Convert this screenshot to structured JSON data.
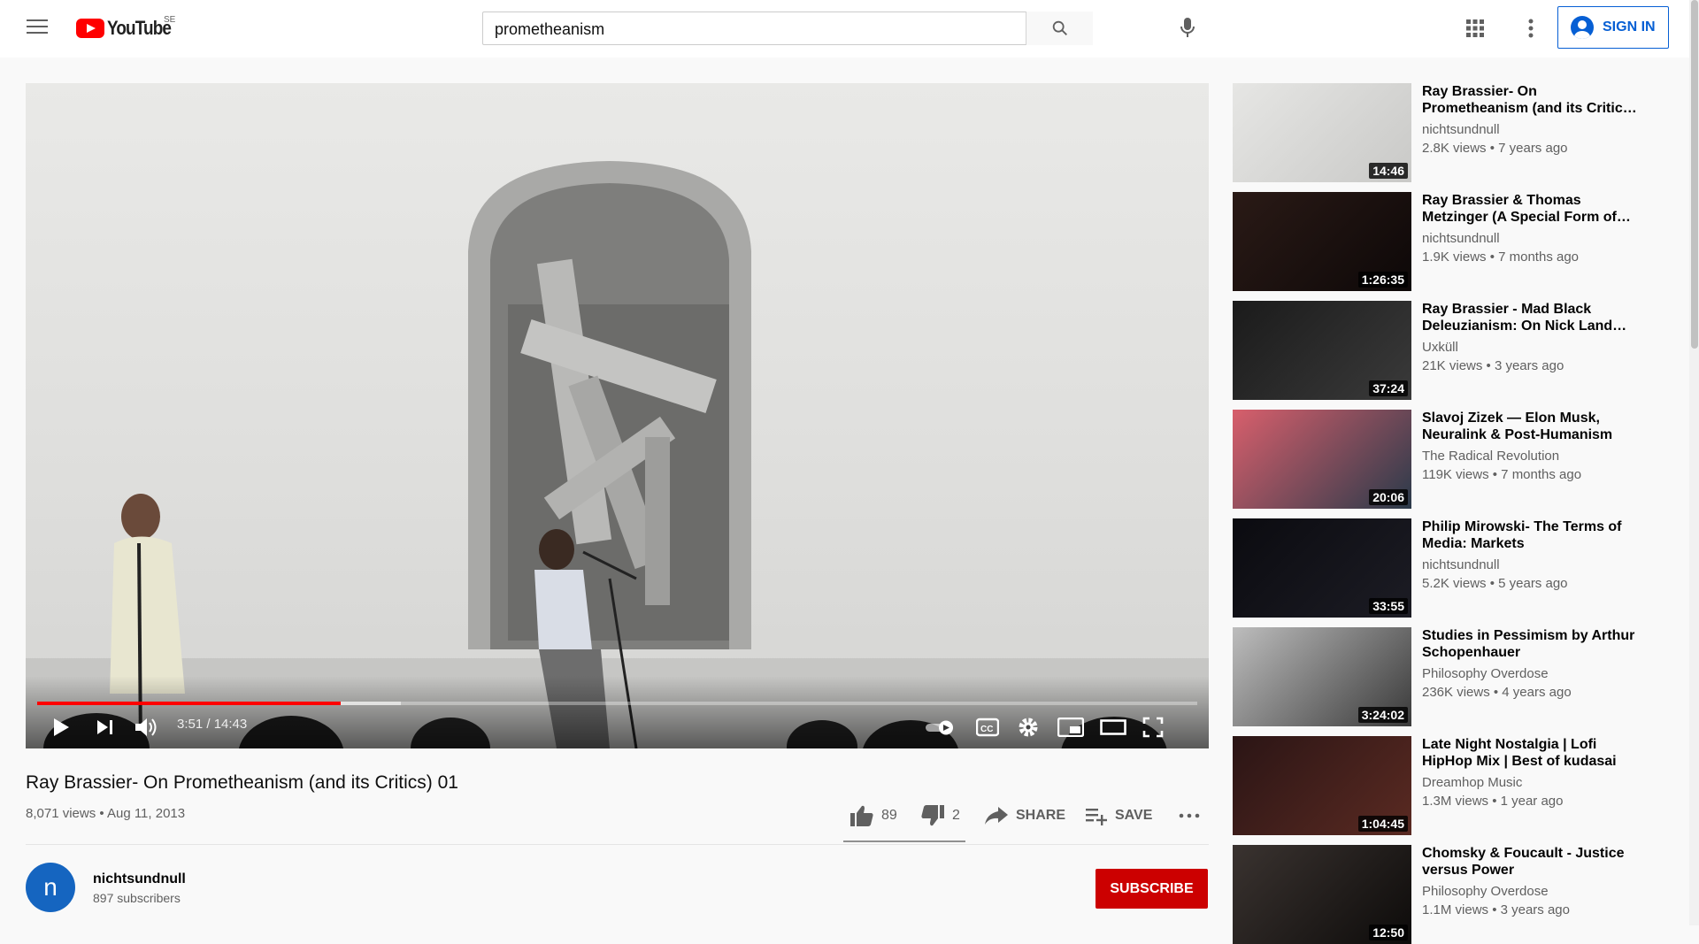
{
  "header": {
    "logo_text": "YouTube",
    "country_code": "SE",
    "search_value": "prometheanism",
    "signin_label": "SIGN IN"
  },
  "player": {
    "time_display": "3:51 / 14:43",
    "progress_fraction": 0.262
  },
  "video": {
    "title": "Ray Brassier- On Prometheanism (and its Critics) 01",
    "meta": "8,071 views • Aug 11, 2013",
    "likes": "89",
    "dislikes": "2",
    "share_label": "SHARE",
    "save_label": "SAVE"
  },
  "channel": {
    "avatar_letter": "n",
    "name": "nichtsundnull",
    "subscribers": "897 subscribers",
    "subscribe_label": "SUBSCRIBE"
  },
  "recommendations": [
    {
      "title": "Ray Brassier- On Prometheanism (and its Critic…",
      "channel": "nichtsundnull",
      "meta": "2.8K views • 7 years ago",
      "duration": "14:46",
      "thumb_colors": [
        "#e6e6e4",
        "#c9c9c7"
      ]
    },
    {
      "title": "Ray Brassier & Thomas Metzinger (A Special Form of…",
      "channel": "nichtsundnull",
      "meta": "1.9K views • 7 months ago",
      "duration": "1:26:35",
      "thumb_colors": [
        "#2a1a16",
        "#0d0808"
      ]
    },
    {
      "title": "Ray Brassier - Mad Black Deleuzianism: On Nick Land…",
      "channel": "Uxküll",
      "meta": "21K views • 3 years ago",
      "duration": "37:24",
      "thumb_colors": [
        "#1b1b1b",
        "#3a3a3a"
      ]
    },
    {
      "title": "Slavoj Zizek — Elon Musk, Neuralink & Post-Humanism",
      "channel": "The Radical Revolution",
      "meta": "119K views • 7 months ago",
      "duration": "20:06",
      "thumb_colors": [
        "#d85f6c",
        "#2a3a4a"
      ]
    },
    {
      "title": "Philip Mirowski- The Terms of Media: Markets",
      "channel": "nichtsundnull",
      "meta": "5.2K views • 5 years ago",
      "duration": "33:55",
      "thumb_colors": [
        "#0b0b10",
        "#1c1c24"
      ]
    },
    {
      "title": "Studies in Pessimism by Arthur Schopenhauer",
      "channel": "Philosophy Overdose",
      "meta": "236K views • 4 years ago",
      "duration": "3:24:02",
      "thumb_colors": [
        "#bdbdbd",
        "#3a3a3a"
      ]
    },
    {
      "title": "Late Night Nostalgia | Lofi HipHop Mix | Best of kudasai",
      "channel": "Dreamhop Music",
      "meta": "1.3M views • 1 year ago",
      "duration": "1:04:45",
      "thumb_colors": [
        "#2b1515",
        "#5a2a22"
      ]
    },
    {
      "title": "Chomsky & Foucault - Justice versus Power",
      "channel": "Philosophy Overdose",
      "meta": "1.1M views • 3 years ago",
      "duration": "12:50",
      "thumb_colors": [
        "#3a3330",
        "#0d0b0a"
      ]
    }
  ]
}
